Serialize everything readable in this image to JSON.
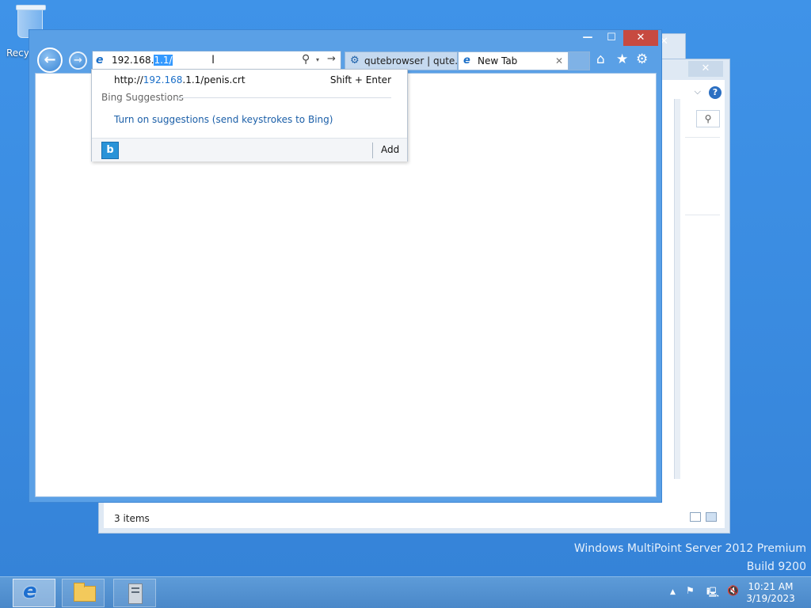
{
  "desktop": {
    "recycle_bin_label": "Recyc",
    "watermark_line1": "Windows MultiPoint Server 2012 Premium",
    "watermark_line2": "Build 9200"
  },
  "explorer_window": {
    "close_glyph": "✕",
    "help_glyph": "?",
    "chevron_glyph": "⌵",
    "search_glyph": "⚲",
    "status_text": "3 items"
  },
  "explorer_window_back": {
    "close_glyph": "✕"
  },
  "ie": {
    "caption": {
      "minimize": "—",
      "maximize": "☐",
      "close": "✕"
    },
    "nav": {
      "back_glyph": "←",
      "forward_glyph": "→"
    },
    "address": {
      "url_typed": "192.168.",
      "url_selected": "1.1/",
      "search_glyph": "⚲",
      "dropdown_glyph": "▾",
      "go_glyph": "→",
      "ie_glyph": "e"
    },
    "tabs": [
      {
        "label": "qutebrowser | qute...",
        "icon": "qutebrowser-icon",
        "glyph": "⚙"
      },
      {
        "label": "New Tab",
        "icon": "ie-icon",
        "glyph": "e",
        "close": "✕"
      }
    ],
    "tools": {
      "home": "⌂",
      "favorites": "★",
      "settings": "⚙"
    }
  },
  "autocomplete": {
    "suggestion_url_prefix": "http://",
    "suggestion_url_match": "192.168",
    "suggestion_url_rest": ".1.1/penis.crt",
    "suggestion_shortcut": "Shift + Enter",
    "section_heading": "Bing Suggestions",
    "turn_on_link": "Turn on suggestions (send keystrokes to Bing)",
    "bing_glyph": "b",
    "add_label": "Add"
  },
  "taskbar": {
    "ie_glyph": "e",
    "tray": {
      "up": "▲",
      "flag": "⚑",
      "network": "🖳",
      "volume": "🔇"
    },
    "time": "10:21 AM",
    "date": "3/19/2023"
  },
  "colors": {
    "desktop_bg": "#3a8be0",
    "window_frame": "#5aa0e6",
    "close_button": "#c74a40",
    "selection": "#3399ff",
    "link": "#1b5fa8"
  }
}
